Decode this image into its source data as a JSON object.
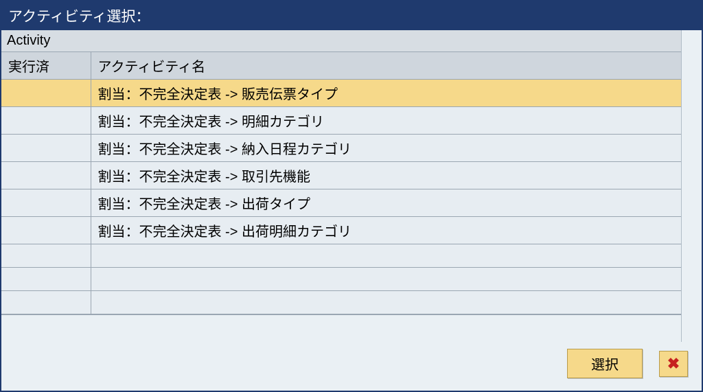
{
  "dialog": {
    "title": "アクティビティ選択：",
    "group_header": "Activity"
  },
  "table": {
    "columns": {
      "executed": "実行済",
      "activity_name": "アクティビティ名"
    },
    "rows": [
      {
        "executed": "",
        "name": "割当：不完全決定表 ->  販売伝票タイプ",
        "selected": true
      },
      {
        "executed": "",
        "name": "割当：不完全決定表 ->  明細カテゴリ",
        "selected": false
      },
      {
        "executed": "",
        "name": "割当：不完全決定表 ->  納入日程カテゴリ",
        "selected": false
      },
      {
        "executed": "",
        "name": "割当：不完全決定表 ->  取引先機能",
        "selected": false
      },
      {
        "executed": "",
        "name": "割当：不完全決定表 ->  出荷タイプ",
        "selected": false
      },
      {
        "executed": "",
        "name": "割当：不完全決定表 ->  出荷明細カテゴリ",
        "selected": false
      },
      {
        "executed": "",
        "name": "",
        "selected": false
      },
      {
        "executed": "",
        "name": "",
        "selected": false
      },
      {
        "executed": "",
        "name": "",
        "selected": false
      }
    ]
  },
  "buttons": {
    "select": "選択",
    "close": "✖"
  }
}
